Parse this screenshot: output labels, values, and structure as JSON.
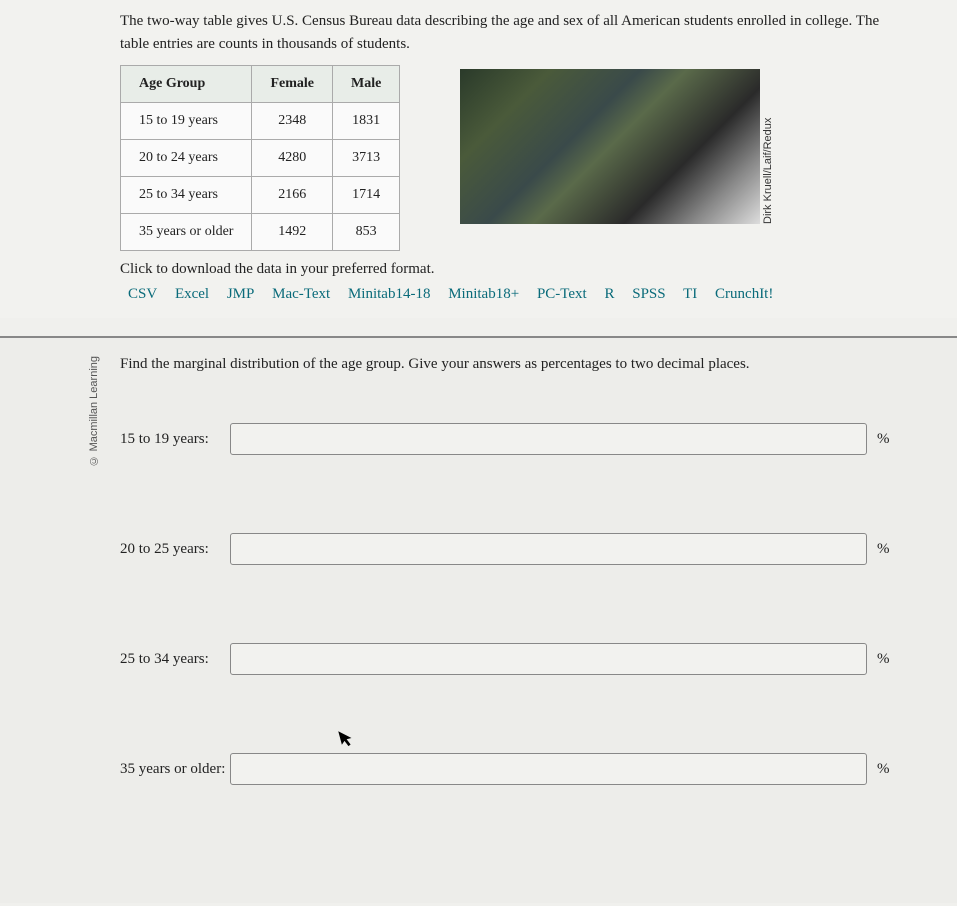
{
  "intro": {
    "line1": "The two-way table gives U.S. Census Bureau data describing the age and sex of all American students enrolled in college.",
    "line2": "The table entries are counts in thousands of students."
  },
  "table": {
    "headers": {
      "c0": "Age Group",
      "c1": "Female",
      "c2": "Male"
    },
    "rows": [
      {
        "label": "15 to 19 years",
        "female": "2348",
        "male": "1831"
      },
      {
        "label": "20 to 24 years",
        "female": "4280",
        "male": "3713"
      },
      {
        "label": "25 to 34 years",
        "female": "2166",
        "male": "1714"
      },
      {
        "label": "35 years or older",
        "female": "1492",
        "male": "853"
      }
    ]
  },
  "image_credit": "Dirk Kruell/Laif/Redux",
  "download": {
    "prompt": "Click to download the data in your preferred format.",
    "links": [
      "CSV",
      "Excel",
      "JMP",
      "Mac-Text",
      "Minitab14-18",
      "Minitab18+",
      "PC-Text",
      "R",
      "SPSS",
      "TI",
      "CrunchIt!"
    ]
  },
  "copyright": "© Macmillan Learning",
  "question": "Find the marginal distribution of the age group. Give your answers as percentages to two decimal places.",
  "answers": [
    {
      "label": "15 to 19 years:",
      "unit": "%"
    },
    {
      "label": "20 to 25 years:",
      "unit": "%"
    },
    {
      "label": "25 to 34 years:",
      "unit": "%"
    },
    {
      "label": "35 years or older:",
      "unit": "%"
    }
  ]
}
